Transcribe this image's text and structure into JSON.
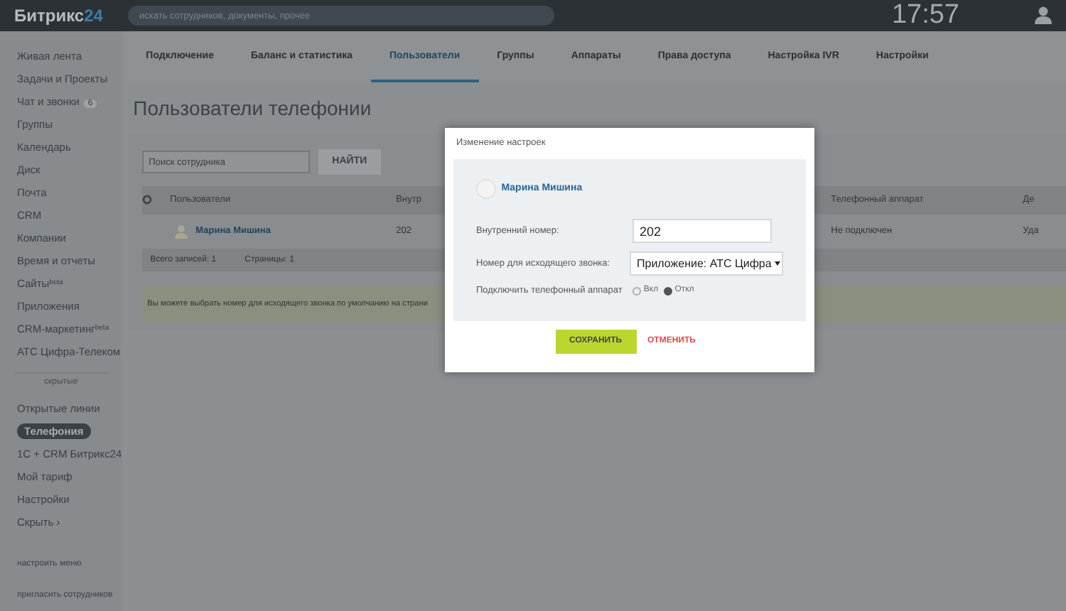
{
  "header": {
    "logo": "Битрикс",
    "logo_accent": "24",
    "search": {
      "placeholder": "искать сотрудников, документы, прочее"
    },
    "time": "17:57"
  },
  "sidebar": {
    "items": [
      {
        "label": "Живая лента",
        "selected": false
      },
      {
        "label": "Задачи и Проекты",
        "selected": false
      },
      {
        "label": "Чат и звонки",
        "badge": "6",
        "selected": false
      },
      {
        "label": "Группы",
        "selected": false
      },
      {
        "label": "Календарь",
        "selected": false
      },
      {
        "label": "Диск",
        "selected": false
      },
      {
        "label": "Почта",
        "selected": false
      },
      {
        "label": "CRM",
        "selected": false
      },
      {
        "label": "Компании",
        "selected": false
      },
      {
        "label": "Время и отчеты",
        "selected": false
      },
      {
        "label": "Сайты",
        "sup": "beta",
        "selected": false
      },
      {
        "label": "Приложения",
        "selected": false
      },
      {
        "label": "CRM-маркетинг",
        "sup": "beta",
        "selected": false
      },
      {
        "label": "АТС Цифра-Телеком",
        "selected": false
      }
    ],
    "divider": "скрытые",
    "hidden_items": [
      {
        "label": "Открытые линии",
        "selected": false
      },
      {
        "label": "Телефония",
        "selected": true
      },
      {
        "label": "1С + CRM Битрикс24",
        "selected": false
      },
      {
        "label": "Мой тариф",
        "selected": false
      },
      {
        "label": "Настройки",
        "selected": false
      },
      {
        "label": "Скрыть ›",
        "selected": false
      }
    ],
    "configure_menu": "настроить меню",
    "invite": "пригласить сотрудников"
  },
  "tabs": [
    {
      "label": "Подключение",
      "selected": false
    },
    {
      "label": "Баланс и статистика",
      "selected": false
    },
    {
      "label": "Пользователи",
      "selected": true
    },
    {
      "label": "Группы",
      "selected": false
    },
    {
      "label": "Аппараты",
      "selected": false
    },
    {
      "label": "Права доступа",
      "selected": false
    },
    {
      "label": "Настройка IVR",
      "selected": false
    },
    {
      "label": "Настройки",
      "selected": false
    }
  ],
  "page_title": "Пользователи телефонии",
  "filter": {
    "placeholder": "Поиск сотрудника",
    "button": "НАЙТИ"
  },
  "table": {
    "columns": [
      "Пользователи",
      "Внутр",
      "Телефонный аппарат",
      "Де"
    ],
    "rows": [
      {
        "user": "Марина Мишина",
        "internal": "202",
        "phone": "Не подключен",
        "column_4": "Уда"
      }
    ],
    "footer": {
      "total": "Всего записей: 1",
      "pages": "Страницы: 1"
    }
  },
  "notice": "Вы можете выбрать номер для исходящего звонка по умолчанию на страни",
  "dialog": {
    "title": "Изменение настроек",
    "user": "Марина Мишина",
    "fields": [
      {
        "kind": "input",
        "label": "Внутренний номер:",
        "value": "202"
      },
      {
        "kind": "select",
        "label": "Номер для исходящего звонка:",
        "value": "Приложение: АТС Цифра"
      },
      {
        "kind": "radio",
        "label": "Подключить телефонный аппарат",
        "options": [
          {
            "label": "Вкл",
            "selected": false
          },
          {
            "label": "Откл",
            "selected": true
          }
        ]
      }
    ],
    "save": "СОХРАНИТЬ",
    "cancel": "ОТМЕНИТЬ"
  }
}
